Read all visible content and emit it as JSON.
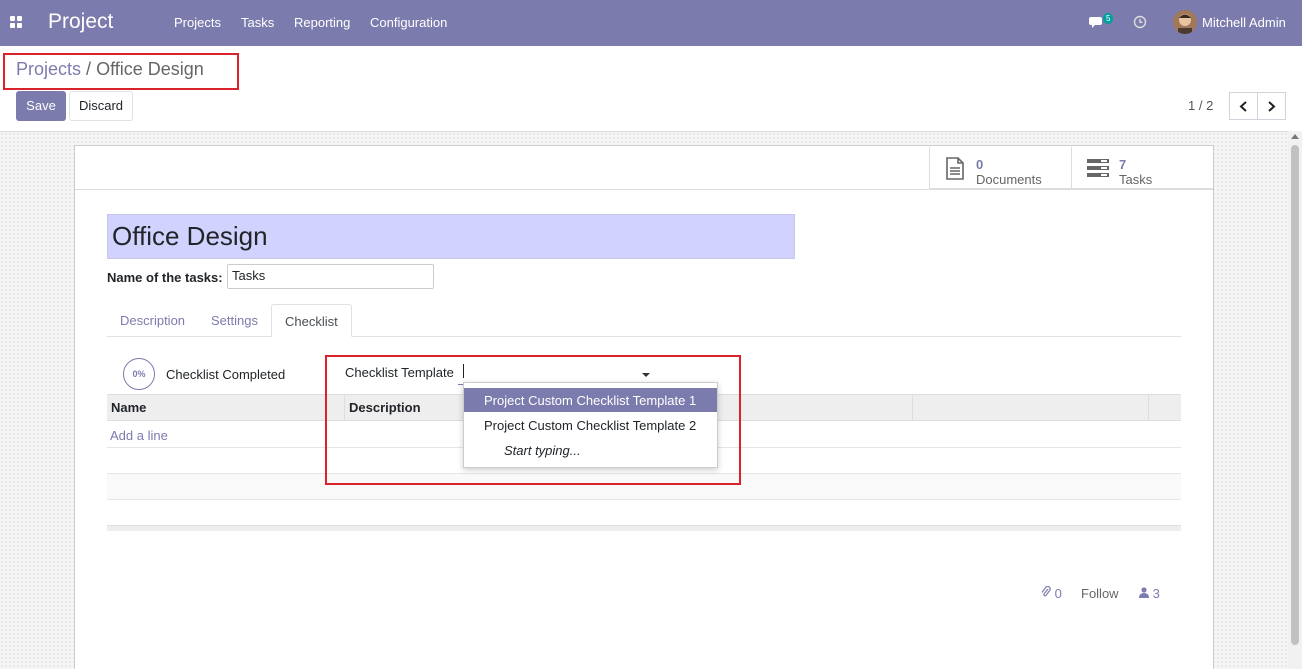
{
  "navbar": {
    "app_name": "Project",
    "menu": [
      "Projects",
      "Tasks",
      "Reporting",
      "Configuration"
    ],
    "messages_count": "5",
    "user_name": "Mitchell Admin"
  },
  "breadcrumb": {
    "parent": "Projects",
    "separator": "/",
    "current": "Office Design"
  },
  "buttons": {
    "save": "Save",
    "discard": "Discard"
  },
  "pager": {
    "value": "1 / 2"
  },
  "stat_buttons": {
    "documents": {
      "value": "0",
      "label": "Documents"
    },
    "tasks": {
      "value": "7",
      "label": "Tasks"
    }
  },
  "form": {
    "title": "Office Design",
    "tasks_label": "Name of the tasks:",
    "tasks_value": "Tasks"
  },
  "tabs": [
    "Description",
    "Settings",
    "Checklist"
  ],
  "checklist": {
    "progress": "0%",
    "completed_label": "Checklist Completed",
    "template_label": "Checklist Template",
    "columns": [
      "Name",
      "Description"
    ],
    "add_line": "Add a line",
    "dropdown": [
      "Project Custom Checklist Template 1",
      "Project Custom Checklist Template 2",
      "Start typing..."
    ]
  },
  "chatter": {
    "attachments": "0",
    "follow": "Follow",
    "followers": "3"
  },
  "colors": {
    "brand": "#7c7bad",
    "highlight_box": "#d9242b",
    "title_bg": "#d2d2ff"
  }
}
